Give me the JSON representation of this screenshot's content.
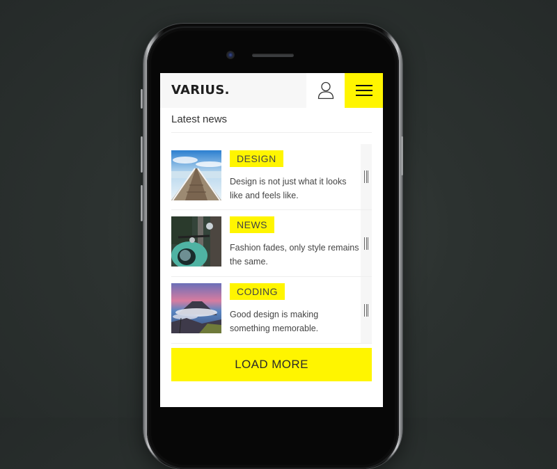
{
  "app": {
    "brand": "VARIUS.",
    "header": {
      "user_icon": "user-icon",
      "menu_icon": "hamburger-menu-icon"
    },
    "section_title": "Latest news",
    "items": [
      {
        "tag": "DESIGN",
        "description": "Design is not just what it looks like and feels like.",
        "thumbnail": "pier-over-sea-image",
        "handle_icon": "drag-handle-icon"
      },
      {
        "tag": "NEWS",
        "description": "Fashion fades, only style remains the same.",
        "thumbnail": "scooter-image",
        "handle_icon": "drag-handle-icon"
      },
      {
        "tag": "CODING",
        "description": "Good design is making something memorable.",
        "thumbnail": "volcano-landscape-image",
        "handle_icon": "drag-handle-icon"
      }
    ],
    "load_more_label": "LOAD MORE"
  },
  "colors": {
    "accent": "#fff500",
    "background": "#2c3230",
    "text": "#444444"
  }
}
